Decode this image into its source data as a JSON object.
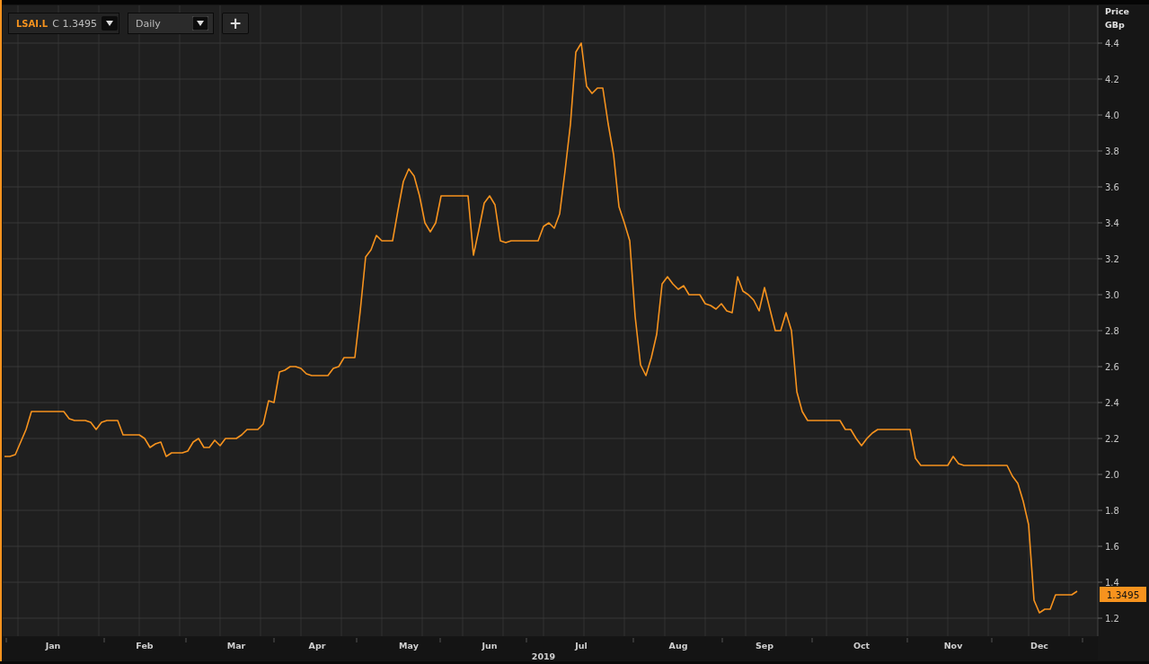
{
  "toolbar": {
    "close_prefix": "C",
    "close_value": "1.3495",
    "interval": "Daily",
    "add_button": "+"
  },
  "axis_title": [
    "Price",
    "GBp"
  ],
  "last_price_label": "1.3495",
  "year_label": "2019",
  "chart_data": {
    "type": "line",
    "grid": true,
    "ylim": [
      1.1,
      4.61
    ],
    "yticks": [
      {
        "value": 1.2,
        "label": "1.2"
      },
      {
        "value": 1.4,
        "label": "1.4"
      },
      {
        "value": 1.6,
        "label": "1.6"
      },
      {
        "value": 1.8,
        "label": "1.8"
      },
      {
        "value": 2,
        "label": "2.0"
      },
      {
        "value": 2.2,
        "label": "2.2"
      },
      {
        "value": 2.4,
        "label": "2.4"
      },
      {
        "value": 2.6,
        "label": "2.6"
      },
      {
        "value": 2.8,
        "label": "2.8"
      },
      {
        "value": 3,
        "label": "3.0"
      },
      {
        "value": 3.2,
        "label": "3.2"
      },
      {
        "value": 3.4,
        "label": "3.4"
      },
      {
        "value": 3.6,
        "label": "3.6"
      },
      {
        "value": 3.8,
        "label": "3.8"
      },
      {
        "value": 4,
        "label": "4.0"
      },
      {
        "value": 4.2,
        "label": "4.2"
      },
      {
        "value": 4.4,
        "label": "4.4"
      }
    ],
    "categories": [
      null,
      null,
      null,
      null,
      null,
      null,
      null,
      null,
      null,
      "Jan",
      null,
      null,
      null,
      null,
      null,
      null,
      null,
      null,
      null,
      null,
      null,
      null,
      null,
      null,
      null,
      null,
      "Feb",
      null,
      null,
      null,
      null,
      null,
      null,
      null,
      null,
      null,
      null,
      null,
      null,
      null,
      null,
      null,
      null,
      "Mar",
      null,
      null,
      null,
      null,
      null,
      null,
      null,
      null,
      null,
      null,
      null,
      null,
      null,
      null,
      "Apr",
      null,
      null,
      null,
      null,
      null,
      null,
      null,
      null,
      null,
      null,
      null,
      null,
      null,
      null,
      null,
      null,
      "May",
      null,
      null,
      null,
      null,
      null,
      null,
      null,
      null,
      null,
      null,
      null,
      null,
      null,
      null,
      "Jun",
      null,
      null,
      null,
      null,
      null,
      null,
      null,
      null,
      null,
      null,
      null,
      null,
      null,
      null,
      null,
      null,
      "Jul",
      null,
      null,
      null,
      null,
      null,
      null,
      null,
      null,
      null,
      null,
      null,
      null,
      null,
      null,
      null,
      null,
      null,
      "Aug",
      null,
      null,
      null,
      null,
      null,
      null,
      null,
      null,
      null,
      null,
      null,
      null,
      null,
      null,
      null,
      "Sep",
      null,
      null,
      null,
      null,
      null,
      null,
      null,
      null,
      null,
      null,
      null,
      null,
      null,
      null,
      null,
      null,
      null,
      "Oct",
      null,
      null,
      null,
      null,
      null,
      null,
      null,
      null,
      null,
      null,
      null,
      null,
      null,
      null,
      null,
      null,
      "Nov",
      null,
      null,
      null,
      null,
      null,
      null,
      null,
      null,
      null,
      null,
      null,
      null,
      null,
      null,
      null,
      "Dec",
      null,
      null,
      null,
      null,
      null,
      null,
      null
    ],
    "series": [
      {
        "name": "LSAI.L",
        "color": "#f7931e",
        "values": [
          2.1,
          2.1,
          2.11,
          2.18,
          2.25,
          2.35,
          2.35,
          2.35,
          2.35,
          2.35,
          2.35,
          2.35,
          2.31,
          2.3,
          2.3,
          2.3,
          2.29,
          2.25,
          2.29,
          2.3,
          2.3,
          2.3,
          2.22,
          2.22,
          2.22,
          2.22,
          2.2,
          2.15,
          2.17,
          2.18,
          2.1,
          2.12,
          2.12,
          2.12,
          2.13,
          2.18,
          2.2,
          2.15,
          2.15,
          2.19,
          2.16,
          2.2,
          2.2,
          2.2,
          2.22,
          2.25,
          2.25,
          2.25,
          2.28,
          2.41,
          2.4,
          2.57,
          2.58,
          2.6,
          2.6,
          2.59,
          2.56,
          2.55,
          2.55,
          2.55,
          2.55,
          2.59,
          2.6,
          2.65,
          2.65,
          2.65,
          2.91,
          3.21,
          3.25,
          3.33,
          3.3,
          3.3,
          3.3,
          3.47,
          3.63,
          3.7,
          3.66,
          3.55,
          3.4,
          3.35,
          3.4,
          3.55,
          3.55,
          3.55,
          3.55,
          3.55,
          3.55,
          3.22,
          3.36,
          3.51,
          3.55,
          3.5,
          3.3,
          3.29,
          3.3,
          3.3,
          3.3,
          3.3,
          3.3,
          3.3,
          3.38,
          3.4,
          3.37,
          3.45,
          3.69,
          3.95,
          4.35,
          4.4,
          4.16,
          4.12,
          4.15,
          4.15,
          3.95,
          3.78,
          3.49,
          3.4,
          3.3,
          2.88,
          2.61,
          2.55,
          2.65,
          2.78,
          3.06,
          3.1,
          3.06,
          3.03,
          3.05,
          3.0,
          3.0,
          3.0,
          2.95,
          2.94,
          2.92,
          2.95,
          2.91,
          2.9,
          3.1,
          3.02,
          3.0,
          2.97,
          2.91,
          3.04,
          2.92,
          2.8,
          2.8,
          2.9,
          2.8,
          2.46,
          2.35,
          2.3,
          2.3,
          2.3,
          2.3,
          2.3,
          2.3,
          2.3,
          2.25,
          2.25,
          2.2,
          2.16,
          2.2,
          2.23,
          2.25,
          2.25,
          2.25,
          2.25,
          2.25,
          2.25,
          2.25,
          2.09,
          2.05,
          2.05,
          2.05,
          2.05,
          2.05,
          2.05,
          2.1,
          2.06,
          2.05,
          2.05,
          2.05,
          2.05,
          2.05,
          2.05,
          2.05,
          2.05,
          2.05,
          1.99,
          1.95,
          1.85,
          1.72,
          1.3,
          1.23,
          1.25,
          1.25,
          1.33,
          1.33,
          1.33,
          1.33,
          1.35
        ]
      }
    ]
  }
}
